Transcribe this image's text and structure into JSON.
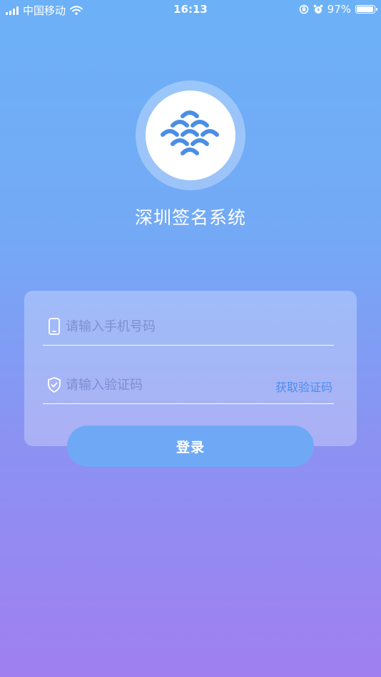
{
  "status_bar": {
    "carrier": "中国移动",
    "time": "16:13",
    "battery_text": "97%",
    "battery_level": 0.97
  },
  "app": {
    "title": "深圳签名系统",
    "logo_color": "#4a8ee6"
  },
  "form": {
    "phone_placeholder": "请输入手机号码",
    "code_placeholder": "请输入验证码",
    "get_code_label": "获取验证码",
    "login_label": "登录"
  },
  "icons": {
    "phone": "mobile-phone-icon",
    "code": "shield-check-icon"
  },
  "colors": {
    "accent": "#4a8ef2",
    "button": "#6fa9f6"
  }
}
